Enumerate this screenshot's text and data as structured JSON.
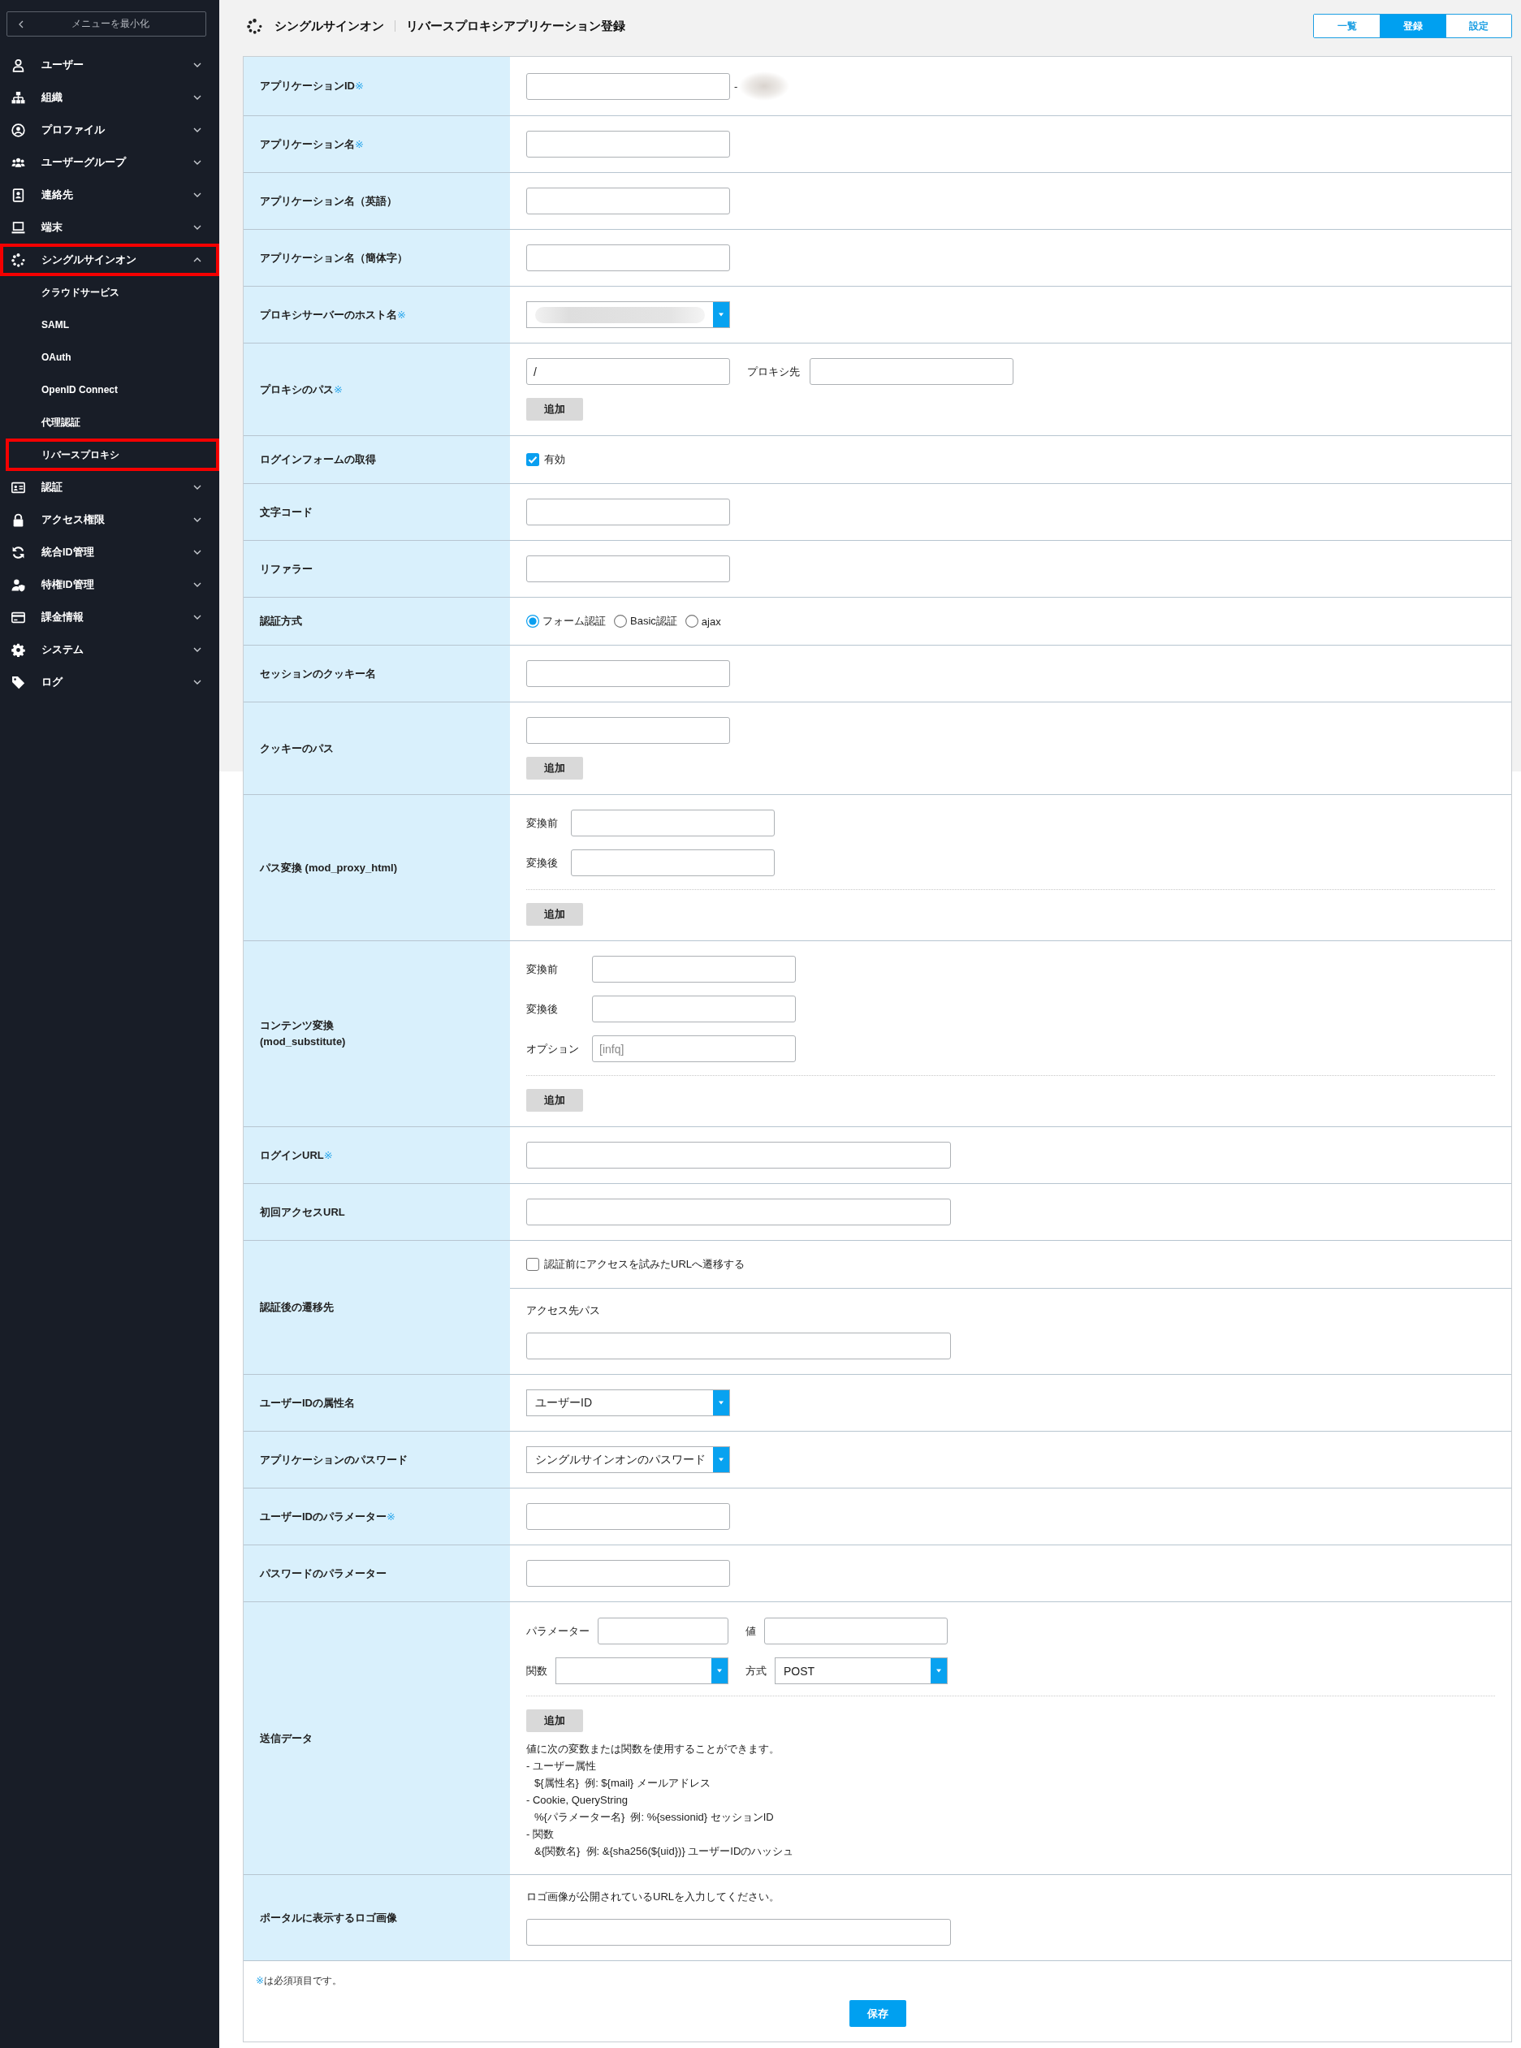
{
  "sidebar": {
    "collapse_button": "メニューを最小化",
    "items": [
      {
        "label": "ユーザー",
        "expanded": false,
        "highlighted": false
      },
      {
        "label": "組織",
        "expanded": false,
        "highlighted": false
      },
      {
        "label": "プロファイル",
        "expanded": false,
        "highlighted": false
      },
      {
        "label": "ユーザーグループ",
        "expanded": false,
        "highlighted": false
      },
      {
        "label": "連絡先",
        "expanded": false,
        "highlighted": false
      },
      {
        "label": "端末",
        "expanded": false,
        "highlighted": false
      },
      {
        "label": "シングルサインオン",
        "expanded": true,
        "highlighted": true,
        "children": [
          {
            "label": "クラウドサービス",
            "highlighted": false
          },
          {
            "label": "SAML",
            "highlighted": false
          },
          {
            "label": "OAuth",
            "highlighted": false
          },
          {
            "label": "OpenID Connect",
            "highlighted": false
          },
          {
            "label": "代理認証",
            "highlighted": false
          },
          {
            "label": "リバースプロキシ",
            "highlighted": true
          }
        ]
      },
      {
        "label": "認証",
        "expanded": false,
        "highlighted": false
      },
      {
        "label": "アクセス権限",
        "expanded": false,
        "highlighted": false
      },
      {
        "label": "統合ID管理",
        "expanded": false,
        "highlighted": false
      },
      {
        "label": "特権ID管理",
        "expanded": false,
        "highlighted": false
      },
      {
        "label": "課金情報",
        "expanded": false,
        "highlighted": false
      },
      {
        "label": "システム",
        "expanded": false,
        "highlighted": false
      },
      {
        "label": "ログ",
        "expanded": false,
        "highlighted": false
      }
    ]
  },
  "header": {
    "section": "シングルサインオン",
    "title": "リバースプロキシアプリケーション登録",
    "tabs": [
      {
        "label": "一覧",
        "selected": false
      },
      {
        "label": "登録",
        "selected": true
      },
      {
        "label": "設定",
        "selected": false
      }
    ]
  },
  "form": {
    "rows": [
      {
        "kind": "text",
        "label": "アプリケーションID",
        "required_mark": "※",
        "suffix": "-",
        "blurred": true
      },
      {
        "kind": "text",
        "label": "アプリケーション名",
        "required_mark": "※"
      },
      {
        "kind": "text",
        "label": "アプリケーション名（英語）"
      },
      {
        "kind": "text",
        "label": "アプリケーション名（簡体字）"
      },
      {
        "kind": "select",
        "label": "プロキシサーバーのホスト名",
        "required_mark": "※",
        "blurred": true
      },
      {
        "kind": "proxypath",
        "label": "プロキシのパス",
        "required_mark": "※",
        "path_value": "/",
        "target_caption": "プロキシ先",
        "add_button": "追加"
      },
      {
        "kind": "checkbox",
        "label": "ログインフォームの取得",
        "option": {
          "label": "有効",
          "checked": true
        }
      },
      {
        "kind": "text",
        "label": "文字コード"
      },
      {
        "kind": "text",
        "label": "リファラー"
      },
      {
        "kind": "radio",
        "label": "認証方式",
        "options": [
          {
            "label": "フォーム認証",
            "selected": true
          },
          {
            "label": "Basic認証",
            "selected": false
          },
          {
            "label": "ajax",
            "selected": false
          }
        ]
      },
      {
        "kind": "text",
        "label": "セッションのクッキー名"
      },
      {
        "kind": "textadd",
        "label": "クッキーのパス",
        "add_button": "追加"
      },
      {
        "kind": "conversion",
        "label": "パス変換 (mod_proxy_html)",
        "fields": [
          {
            "caption": "変換前"
          },
          {
            "caption": "変換後"
          }
        ],
        "add_button": "追加"
      },
      {
        "kind": "conversion",
        "label": "コンテンツ変換\n(mod_substitute)",
        "fields": [
          {
            "caption": "変換前"
          },
          {
            "caption": "変換後"
          },
          {
            "caption": "オプション",
            "placeholder": "[infq]"
          }
        ],
        "add_button": "追加"
      },
      {
        "kind": "url",
        "label": "ログインURL",
        "required_mark": "※"
      },
      {
        "kind": "url",
        "label": "初回アクセスURL"
      },
      {
        "kind": "redirect",
        "label": "認証後の遷移先",
        "option": {
          "label": "認証前にアクセスを試みたURLへ遷移する",
          "checked": false
        },
        "caption": "アクセス先パス"
      },
      {
        "kind": "select",
        "label": "ユーザーIDの属性名",
        "value": "ユーザーID"
      },
      {
        "kind": "select",
        "label": "アプリケーションのパスワード",
        "value": "シングルサインオンのパスワード"
      },
      {
        "kind": "text",
        "label": "ユーザーIDのパラメーター",
        "required_mark": "※"
      },
      {
        "kind": "text",
        "label": "パスワードのパラメーター"
      },
      {
        "kind": "senddata",
        "label": "送信データ",
        "parameter_caption": "パラメーター",
        "value_caption": "値",
        "function_caption": "関数",
        "method_caption": "方式",
        "method_value": "POST",
        "add_button": "追加",
        "help": {
          "intro": "値に次の変数または関数を使用することができます。",
          "groups": [
            {
              "title": "- ユーザー属性",
              "example": "${属性名}  例: ${mail} メールアドレス"
            },
            {
              "title": "- Cookie, QueryString",
              "example": "%{パラメーター名}  例: %{sessionid} セッションID"
            },
            {
              "title": "- 関数",
              "example": "&{関数名}  例: &{sha256(${uid})} ユーザーIDのハッシュ"
            }
          ]
        }
      },
      {
        "kind": "logo",
        "label": "ポータルに表示するロゴ画像",
        "hint": "ロゴ画像が公開されているURLを入力してください。"
      }
    ],
    "required_note": {
      "mark": "※",
      "text": "は必須項目です。"
    },
    "save_button": "保存"
  }
}
